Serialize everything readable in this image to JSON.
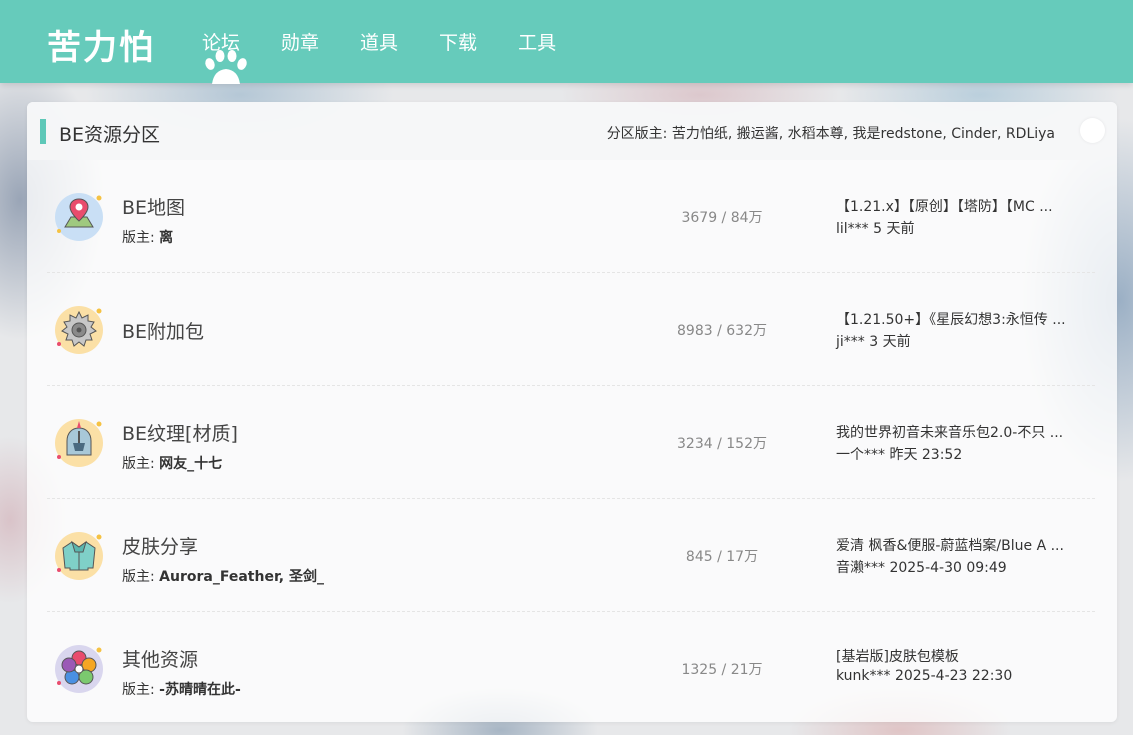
{
  "site": {
    "logo": "苦力怕"
  },
  "nav": {
    "items": [
      {
        "label": "论坛"
      },
      {
        "label": "勋章"
      },
      {
        "label": "道具"
      },
      {
        "label": "下载"
      },
      {
        "label": "工具"
      }
    ]
  },
  "section": {
    "title": "BE资源分区",
    "moderators": "分区版主: 苦力怕纸, 搬运酱, 水稻本尊, 我是redstone, Cinder, RDLiya"
  },
  "forums": [
    {
      "name": "BE地图",
      "mod_prefix": "版主: ",
      "mods": "离",
      "stats": "3679 / 84万",
      "last_title": "【1.21.x】【原创】【塔防】【MC ...",
      "last_meta": "lil*** 5 天前",
      "icon": "map-pin-icon"
    },
    {
      "name": "BE附加包",
      "mod_prefix": "",
      "mods": "",
      "stats": "8983 / 632万",
      "last_title": "【1.21.50+】《星辰幻想3:永恒传 ...",
      "last_meta": "ji*** 3 天前",
      "icon": "saw-blade-icon"
    },
    {
      "name": "BE纹理[材质]",
      "mod_prefix": "版主: ",
      "mods": "网友_十七",
      "stats": "3234 / 152万",
      "last_title": "我的世界初音未来音乐包2.0-不只 ...",
      "last_meta": "一个*** 昨天 23:52",
      "icon": "helmet-icon"
    },
    {
      "name": "皮肤分享",
      "mod_prefix": "版主: ",
      "mods": "Aurora_Feather, 圣剑_",
      "stats": "845 / 17万",
      "last_title": "爱清 枫香&便服-蔚蓝档案/Blue A ...",
      "last_meta": "音濑*** 2025-4-30 09:49",
      "icon": "sweater-icon"
    },
    {
      "name": "其他资源",
      "mod_prefix": "版主: ",
      "mods": "-苏晴晴在此-",
      "stats": "1325 / 21万",
      "last_title": "[基岩版]皮肤包模板",
      "last_meta": "kunk*** 2025-4-23 22:30",
      "icon": "flower-icon"
    }
  ],
  "colors": {
    "header": "#66cbbb",
    "accent": "#5ec8b8"
  }
}
